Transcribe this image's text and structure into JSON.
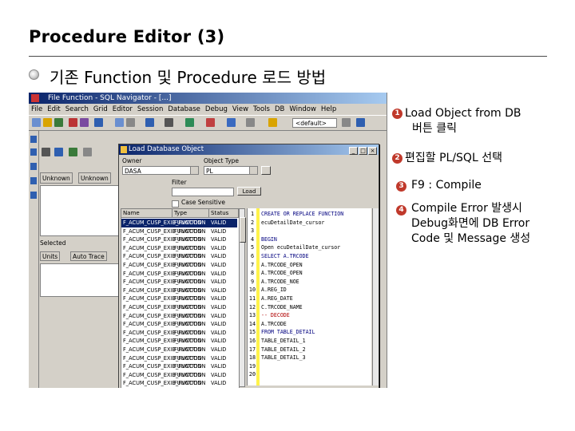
{
  "slide": {
    "title": "Procedure Editor (3)",
    "subtitle": "기존 Function 및 Procedure 로드 방법",
    "bullet_icon": "circle-bullet-icon"
  },
  "app": {
    "window_title": "File Function - SQL Navigator - [...]",
    "menu": [
      "File",
      "Edit",
      "Search",
      "Grid",
      "Editor",
      "Session",
      "Database",
      "Debug",
      "View",
      "Tools",
      "DB",
      "Window",
      "Help"
    ],
    "toolbar_combo": "<default>"
  },
  "left_panel": {
    "tab1": "Unknown",
    "tab2": "Unknown",
    "label": "Selected",
    "tab3": "Units",
    "tab4": "Auto Trace"
  },
  "dialog": {
    "title": "Load Database Object",
    "owner_label": "Owner",
    "owner_value": "DASA",
    "object_type_label": "Object Type",
    "object_type_value": "PL",
    "filter_label": "Filter",
    "button_label": "Load",
    "checkbox_label": "Case Sensitive",
    "columns": [
      "Name",
      "Type",
      "Status"
    ],
    "rows": [
      {
        "name": "F_ACUM_CUSP_EXIB_FUNCTION",
        "type": "FUNCTION",
        "status": "VALID",
        "selected": true
      },
      {
        "name": "F_ACUM_CUSP_EXIB_FUNCTION",
        "type": "FUNCTION",
        "status": "VALID"
      },
      {
        "name": "F_ACUM_CUSP_EXIB_FUNCTION",
        "type": "FUNCTION",
        "status": "VALID"
      },
      {
        "name": "F_ACUM_CUSP_EXIB_FUNCTION",
        "type": "FUNCTION",
        "status": "VALID"
      },
      {
        "name": "F_ACUM_CUSP_EXIB_FUNCTION",
        "type": "FUNCTION",
        "status": "VALID"
      },
      {
        "name": "F_ACUM_CUSP_EXIB_FUNCTION",
        "type": "FUNCTION",
        "status": "VALID"
      },
      {
        "name": "F_ACUM_CUSP_EXIB_FUNCTION",
        "type": "FUNCTION",
        "status": "VALID"
      },
      {
        "name": "F_ACUM_CUSP_EXIB_FUNCTION",
        "type": "FUNCTION",
        "status": "VALID"
      },
      {
        "name": "F_ACUM_CUSP_EXIB_FUNCTION",
        "type": "FUNCTION",
        "status": "VALID"
      },
      {
        "name": "F_ACUM_CUSP_EXIB_FUNCTION",
        "type": "FUNCTION",
        "status": "VALID"
      },
      {
        "name": "F_ACUM_CUSP_EXIB_FUNCTION",
        "type": "FUNCTION",
        "status": "VALID"
      },
      {
        "name": "F_ACUM_CUSP_EXIB_FUNCTION",
        "type": "FUNCTION",
        "status": "VALID"
      },
      {
        "name": "F_ACUM_CUSP_EXIB_FUNCTION",
        "type": "FUNCTION",
        "status": "VALID"
      },
      {
        "name": "F_ACUM_CUSP_EXIB_FUNCTION",
        "type": "FUNCTION",
        "status": "VALID"
      },
      {
        "name": "F_ACUM_CUSP_EXIB_FUNCTION",
        "type": "FUNCTION",
        "status": "VALID"
      },
      {
        "name": "F_ACUM_CUSP_EXIB_FUNCTION",
        "type": "FUNCTION",
        "status": "VALID"
      },
      {
        "name": "F_ACUM_CUSP_EXIB_FUNCTION",
        "type": "FUNCTION",
        "status": "VALID"
      },
      {
        "name": "F_ACUM_CUSP_EXIB_FUNCTION",
        "type": "FUNCTION",
        "status": "VALID"
      },
      {
        "name": "F_ACUM_CUSP_EXIB_FUNCTION",
        "type": "FUNCTION",
        "status": "VALID"
      },
      {
        "name": "F_ACUM_CUSP_EXIB_FUNCTION",
        "type": "FUNCTION",
        "status": "VALID"
      }
    ]
  },
  "editor": {
    "line_numbers": [
      "1",
      "2",
      "3",
      "4",
      "5",
      "6",
      "7",
      "8",
      "9",
      "10",
      "11",
      "12",
      "13",
      "14",
      "15",
      "16",
      "17",
      "18",
      "19",
      "20"
    ],
    "lines": [
      {
        "text": "CREATE OR REPLACE FUNCTION",
        "kind": "kw"
      },
      {
        "text": "  ecuDetailDate_cursor",
        "kind": "plain"
      },
      {
        "text": "",
        "kind": "plain"
      },
      {
        "text": "BEGIN",
        "kind": "kw"
      },
      {
        "text": "  Open ecuDetailDate_cursor",
        "kind": "plain"
      },
      {
        "text": "    SELECT   A.TRCODE",
        "kind": "kw"
      },
      {
        "text": "             A.TRCODE_OPEN",
        "kind": "plain"
      },
      {
        "text": "             A.TRCODE_OPEN",
        "kind": "plain"
      },
      {
        "text": "             A.TRCODE_NOE",
        "kind": "plain"
      },
      {
        "text": "             A.REG_ID",
        "kind": "plain"
      },
      {
        "text": "             A.REG_DATE",
        "kind": "plain"
      },
      {
        "text": "             C.TRCODE_NAME",
        "kind": "plain"
      },
      {
        "text": "             -- DECODE",
        "kind": "cm"
      },
      {
        "text": "             A.TRCODE",
        "kind": "plain"
      },
      {
        "text": "    FROM     TABLE_DETAIL",
        "kind": "kw"
      },
      {
        "text": "             TABLE_DETAIL_1",
        "kind": "plain"
      },
      {
        "text": "             TABLE_DETAIL_2",
        "kind": "plain"
      },
      {
        "text": "             TABLE_DETAIL_3",
        "kind": "plain"
      },
      {
        "text": "",
        "kind": "plain"
      },
      {
        "text": "",
        "kind": "plain"
      }
    ]
  },
  "annotations": [
    {
      "number": "1",
      "line1": "Load Object from DB",
      "line2": "버튼 클릭"
    },
    {
      "number": "2",
      "line1": "편집할 PL/SQL 선택"
    },
    {
      "number": "3",
      "line1": "F9 : Compile"
    },
    {
      "number": "4",
      "line1": "Compile Error 발생시",
      "line2": "Debug화면에 DB Error",
      "line3": "Code 및 Message 생성"
    }
  ],
  "colors": {
    "annotation_badge": "#c0392b",
    "title_bar": "#0a246a",
    "selection": "#0a246a"
  }
}
